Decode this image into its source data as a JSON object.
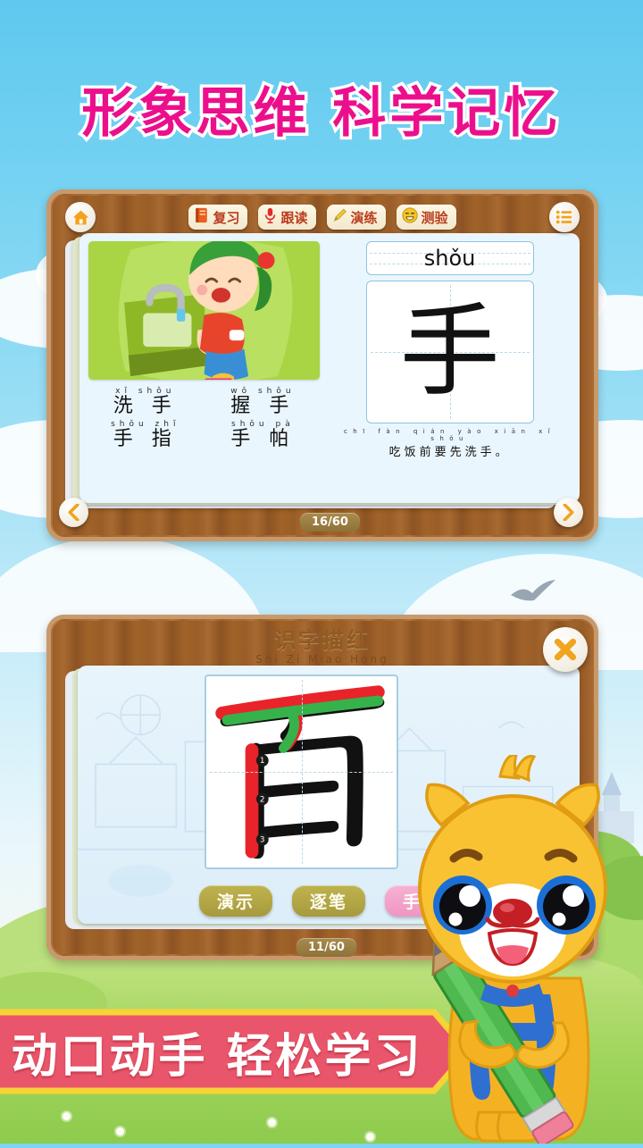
{
  "headline_top": "形象思维  科学记忆",
  "headline_bottom": "动口动手  轻松学习",
  "colors": {
    "headline_top_color": "#ec0f8c",
    "headline_top_outline": "#ffffff",
    "banner_bg": "#e9556a",
    "banner_border": "#f7d336",
    "banner_text": "#ffffff",
    "wood_frame": "#a9682f",
    "sky_top": "#5fc8ee",
    "ground_green": "#9fd45c",
    "active_pill": "#ef95c3",
    "idle_pill": "#a79a3d",
    "stroke_red": "#e8242a",
    "stroke_green": "#36b24a",
    "char_black": "#111111"
  },
  "study_panel": {
    "toolbar": {
      "home_icon": "home-icon",
      "menu_icon": "list-menu-icon",
      "buttons": [
        {
          "label": "复习",
          "icon": "book-icon"
        },
        {
          "label": "跟读",
          "icon": "microphone-icon"
        },
        {
          "label": "演练",
          "icon": "pencil-icon"
        },
        {
          "label": "测验",
          "icon": "smiley-face-icon"
        }
      ]
    },
    "illustration_alt": "girl-washing-hands-illustration",
    "words": [
      {
        "pinyin": "xǐ  shǒu",
        "hanzi": "洗 手"
      },
      {
        "pinyin": "wǒ  shǒu",
        "hanzi": "握 手"
      },
      {
        "pinyin": "shǒu zhǐ",
        "hanzi": "手 指"
      },
      {
        "pinyin": "shǒu  pà",
        "hanzi": "手 帕"
      }
    ],
    "pinyin": "shǒu",
    "character": "手",
    "sentence_pinyin": "chī fàn qián yào xiān xǐ shǒu",
    "sentence_hanzi": "吃饭前要先洗手。",
    "prev_label": "‹",
    "next_label": "›",
    "counter": "16/60"
  },
  "trace_panel": {
    "title_cn": "识字描红",
    "title_py": "Shi Zi Miao Hong",
    "close_icon": "close-x-icon",
    "character": "百",
    "buttons": [
      {
        "label": "演示",
        "state": "idle"
      },
      {
        "label": "逐笔",
        "state": "idle"
      },
      {
        "label": "手写",
        "state": "active"
      }
    ],
    "counter": "11/60"
  },
  "mascot": {
    "name": "yellow-bear-mascot-with-pencil"
  }
}
